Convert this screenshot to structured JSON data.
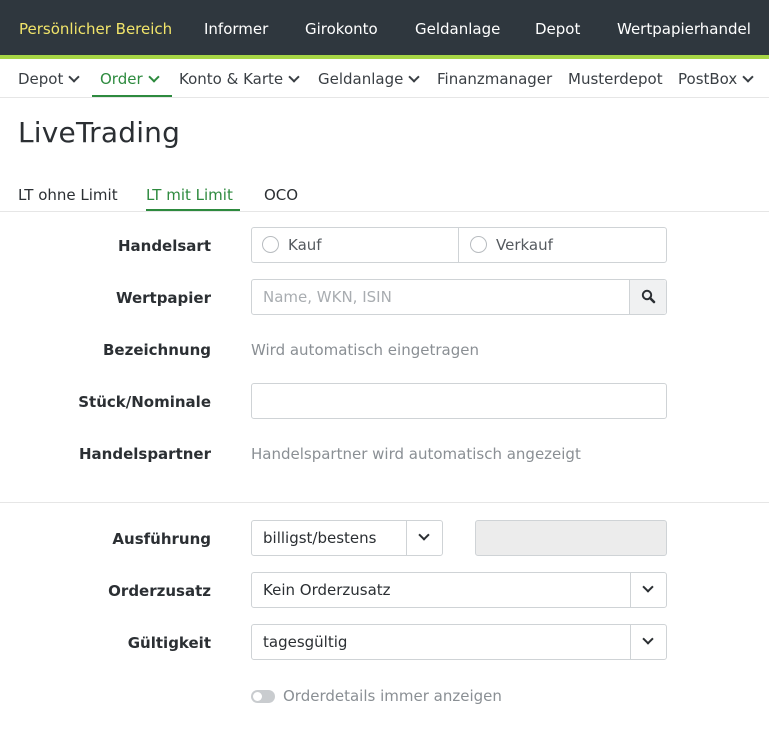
{
  "topnav": {
    "items": [
      {
        "label": "Persönlicher Bereich"
      },
      {
        "label": "Informer"
      },
      {
        "label": "Girokonto"
      },
      {
        "label": "Geldanlage"
      },
      {
        "label": "Depot"
      },
      {
        "label": "Wertpapierhandel"
      }
    ],
    "active_color": "#f1e46a",
    "background": "#2f373e"
  },
  "accent_bar_color": "#a7d545",
  "subnav": {
    "items": [
      {
        "label": "Depot",
        "has_dropdown": true
      },
      {
        "label": "Order",
        "has_dropdown": true,
        "active": true
      },
      {
        "label": "Konto & Karte",
        "has_dropdown": true
      },
      {
        "label": "Geldanlage",
        "has_dropdown": true
      },
      {
        "label": "Finanzmanager",
        "has_dropdown": false
      },
      {
        "label": "Musterdepot",
        "has_dropdown": false
      },
      {
        "label": "PostBox",
        "has_dropdown": true
      }
    ],
    "active_color": "#2d8a3e"
  },
  "page": {
    "title": "LiveTrading"
  },
  "tabs": [
    {
      "label": "LT ohne Limit"
    },
    {
      "label": "LT mit Limit",
      "active": true
    },
    {
      "label": "OCO"
    }
  ],
  "form": {
    "handelsart": {
      "label": "Handelsart",
      "options": [
        "Kauf",
        "Verkauf"
      ]
    },
    "wertpapier": {
      "label": "Wertpapier",
      "placeholder": "Name, WKN, ISIN",
      "icon": "search-icon"
    },
    "bezeichnung": {
      "label": "Bezeichnung",
      "value": "Wird automatisch eingetragen"
    },
    "stueck": {
      "label": "Stück/Nominale",
      "value": ""
    },
    "handelspartner": {
      "label": "Handelspartner",
      "value": "Handelspartner wird automatisch angezeigt"
    },
    "ausfuehrung": {
      "label": "Ausführung",
      "selected": "billigst/bestens",
      "limit_value": ""
    },
    "orderzusatz": {
      "label": "Orderzusatz",
      "selected": "Kein Orderzusatz"
    },
    "gueltigkeit": {
      "label": "Gültigkeit",
      "selected": "tagesgültig"
    },
    "orderdetails_toggle": {
      "label": "Orderdetails immer anzeigen",
      "enabled": false
    }
  }
}
